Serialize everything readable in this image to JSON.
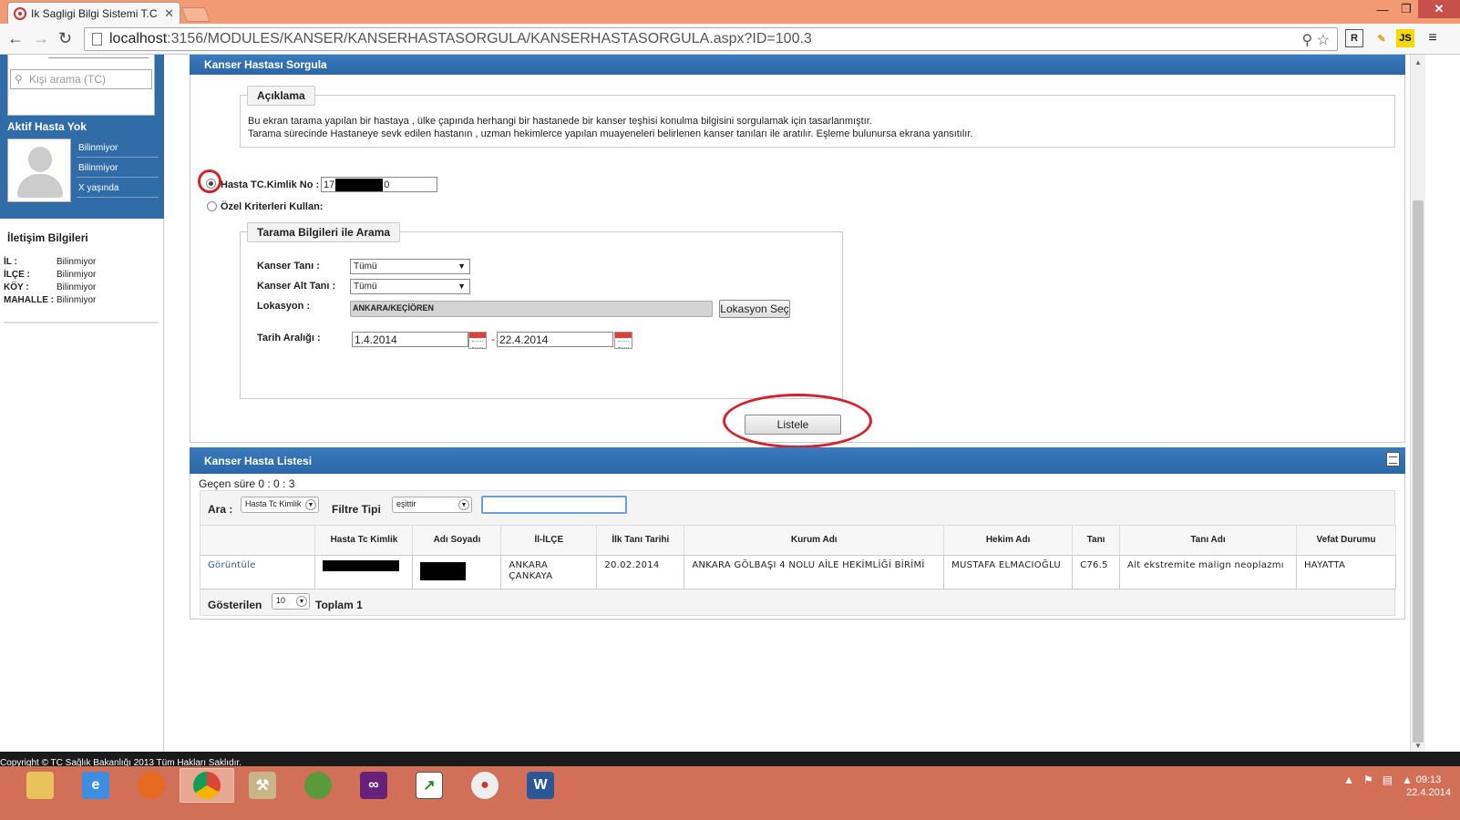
{
  "browser": {
    "tab_title": "Ik Sagligi Bilgi Sistemi T.C",
    "url_host": "localhost",
    "url_path": ":3156/MODULES/KANSER/KANSERHASTASORGULA/KANSERHASTASORGULA.aspx?ID=100.3",
    "window_controls": [
      "—",
      "❐",
      "✕"
    ],
    "extension_js_label": "JS"
  },
  "left_panel": {
    "search_placeholder": "Kişi arama (TC)",
    "aktif_hasta": "Aktif Hasta Yok",
    "patient_info": [
      "Bilinmiyor",
      "Bilinmiyor",
      "X yaşında"
    ],
    "iletisim_title": "İletişim Bilgileri",
    "contact": [
      {
        "label": "İL :",
        "value": "Bilinmiyor"
      },
      {
        "label": "İLÇE :",
        "value": "Bilinmiyor"
      },
      {
        "label": "KÖY :",
        "value": "Bilinmiyor"
      },
      {
        "label": "MAHALLE :",
        "value": "Bilinmiyor"
      }
    ]
  },
  "sorgu_panel": {
    "title": "Kanser Hastası Sorgula",
    "aciklama_legend": "Açıklama",
    "aciklama_line1": "Bu ekran tarama yapılan bir hastaya , ülke çapında herhangi bir hastanede bir kanser teşhisi konulma bilgisini sorgulamak için tasarlanmıştır.",
    "aciklama_line2": "Tarama sürecinde Hastaneye sevk edilen hastanın , uzman hekimlerce yapılan muayeneleri belirlenen kanser tanıları ile aratılır. Eşleme bulunursa ekrana yansıtılır.",
    "radio_tc_label": "Hasta TC.Kimlik No :",
    "tc_prefix": "17",
    "tc_suffix": "0",
    "radio_ozel_label": "Özel Kriterleri Kullan:",
    "tarama_legend": "Tarama Bilgileri ile Arama",
    "kanser_tani_label": "Kanser Tanı :",
    "kanser_tani_value": "Tümü",
    "kanser_alt_tani_label": "Kanser Alt Tanı :",
    "kanser_alt_tani_value": "Tümü",
    "lokasyon_label": "Lokasyon :",
    "lokasyon_value": "ANKARA/KEÇİÖREN",
    "lokasyon_button": "Lokasyon Seç",
    "tarih_label": "Tarih Aralığı :",
    "tarih_start": "1.4.2014",
    "tarih_sep": "-",
    "tarih_end": "22.4.2014",
    "listele_button": "Listele"
  },
  "list_panel": {
    "title": "Kanser Hasta Listesi",
    "gecen_sure": "Geçen süre 0 : 0 : 3",
    "ara_label": "Ara :",
    "ara_select": "Hasta Tc Kimlik",
    "filtre_label": "Filtre Tipi",
    "filtre_select": "eşittir",
    "filter_value": "",
    "columns": [
      "",
      "Hasta Tc Kimlik",
      "Adı Soyadı",
      "İl-İLÇE",
      "İlk Tanı Tarihi",
      "Kurum Adı",
      "Hekim Adı",
      "Tanı",
      "Tanı Adı",
      "Vefat Durumu"
    ],
    "rows": [
      {
        "action": "Görüntüle",
        "il_ilce": "ANKARA ÇANKAYA",
        "ilk_tani_tarihi": "20.02.2014",
        "kurum": "ANKARA GÖLBAŞI 4 NOLU AİLE HEKİMLİĞİ BİRİMİ",
        "hekim": "MUSTAFA ELMACIOĞLU",
        "tani": "C76.5",
        "tani_adi": "Alt ekstremite malign neoplazmı",
        "vefat": "HAYATTA"
      }
    ],
    "gosterilen_label": "Gösterilen",
    "page_size": "10",
    "toplam": "Toplam 1"
  },
  "footer_text": "Copyright © TC Sağlık Bakanlığı 2013 Tüm Hakları Saklıdır.",
  "taskbar": {
    "apps": [
      "file-explorer-icon",
      "internet-explorer-icon",
      "firefox-icon",
      "chrome-icon",
      "tools-icon",
      "frog-app-icon",
      "visual-studio-icon",
      "chart-app-icon",
      "paint-icon",
      "word-icon"
    ],
    "clock_time": "09:13",
    "clock_date": "22.4.2014"
  },
  "colors": {
    "titlebar": "#f29b73",
    "panel_header": "#2f6ca8",
    "highlight_circle": "#d4222b",
    "taskbar": "#d16f57"
  }
}
